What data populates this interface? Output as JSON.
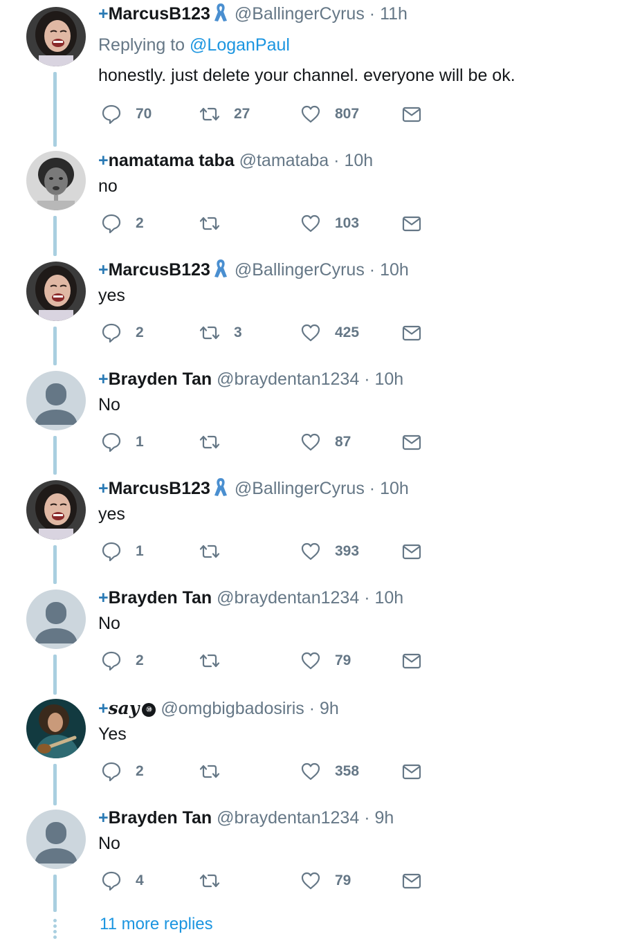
{
  "tweets": [
    {
      "avatar": "woman-laughing-avatar",
      "plus": "+",
      "name": "MarcusB123",
      "ribbon": true,
      "handle": "@BallingerCyrus",
      "dot": "·",
      "time": "11h",
      "replying_prefix": "Replying to ",
      "replying_to": "@LoganPaul",
      "text": "honestly. just delete your channel. everyone will be ok.",
      "replies": "70",
      "retweets": "27",
      "likes": "807"
    },
    {
      "avatar": "woman-portrait-avatar",
      "plus": "+",
      "name": "namatama taba",
      "handle": "@tamataba",
      "dot": "·",
      "time": "10h",
      "text": "no",
      "replies": "2",
      "retweets": "",
      "likes": "103"
    },
    {
      "avatar": "woman-laughing-avatar",
      "plus": "+",
      "name": "MarcusB123",
      "ribbon": true,
      "handle": "@BallingerCyrus",
      "dot": "·",
      "time": "10h",
      "text": "yes",
      "replies": "2",
      "retweets": "3",
      "likes": "425"
    },
    {
      "avatar": "default-user-avatar",
      "plus": "+",
      "name": "Brayden Tan",
      "handle": "@braydentan1234",
      "dot": "·",
      "time": "10h",
      "text": "No",
      "replies": "1",
      "retweets": "",
      "likes": "87"
    },
    {
      "avatar": "woman-laughing-avatar",
      "plus": "+",
      "name": "MarcusB123",
      "ribbon": true,
      "handle": "@BallingerCyrus",
      "dot": "·",
      "time": "10h",
      "text": "yes",
      "replies": "1",
      "retweets": "",
      "likes": "393"
    },
    {
      "avatar": "default-user-avatar",
      "plus": "+",
      "name": "Brayden Tan",
      "handle": "@braydentan1234",
      "dot": "·",
      "time": "10h",
      "text": "No",
      "replies": "2",
      "retweets": "",
      "likes": "79"
    },
    {
      "avatar": "guitar-player-avatar",
      "plus": "+",
      "name": "say",
      "badge": "⑩",
      "handle": "@omgbigbadosiris",
      "dot": "·",
      "time": "9h",
      "text": "Yes",
      "replies": "2",
      "retweets": "",
      "likes": "358"
    },
    {
      "avatar": "default-user-avatar",
      "plus": "+",
      "name": "Brayden Tan",
      "handle": "@braydentan1234",
      "dot": "·",
      "time": "9h",
      "text": "No",
      "replies": "4",
      "retweets": "",
      "likes": "79"
    }
  ],
  "more_replies": "11 more replies",
  "colors": {
    "link": "#1b95e0",
    "muted": "#657786",
    "thread_line": "#a9cfe0",
    "ribbon": "#4a8fd0"
  }
}
